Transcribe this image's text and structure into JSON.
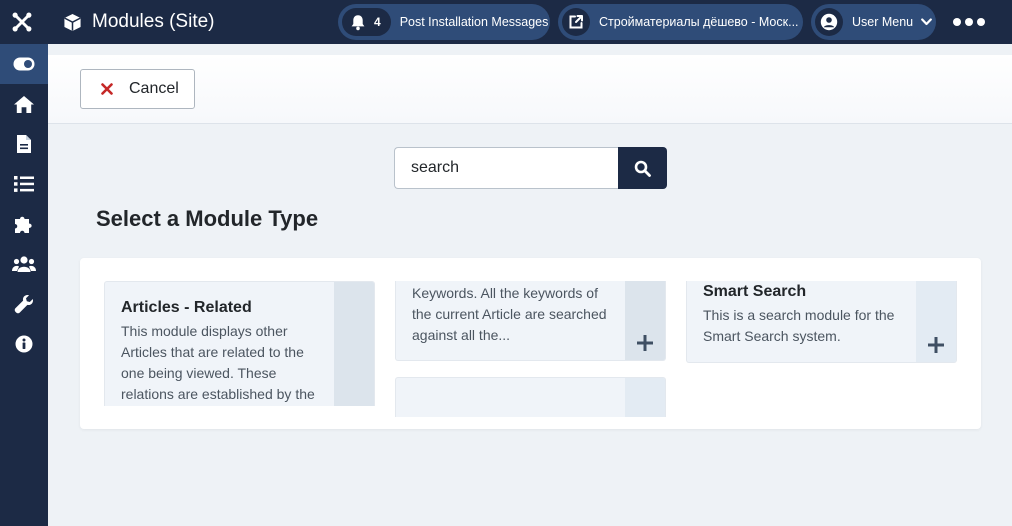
{
  "header": {
    "title": "Modules (Site)",
    "notifications": {
      "count": "4",
      "label": "Post Installation Messages"
    },
    "site_link": {
      "label": "Стройматериалы дёшево - Моск..."
    },
    "user_menu": {
      "label": "User Menu"
    }
  },
  "sidebar": {
    "items": [
      {
        "icon": "toggle-menu-icon"
      },
      {
        "icon": "home-icon"
      },
      {
        "icon": "file-icon"
      },
      {
        "icon": "list-icon"
      },
      {
        "icon": "puzzle-icon"
      },
      {
        "icon": "users-icon"
      },
      {
        "icon": "wrench-icon"
      },
      {
        "icon": "info-icon"
      }
    ]
  },
  "toolbar": {
    "cancel_label": "Cancel"
  },
  "search": {
    "value": "search"
  },
  "main": {
    "section_title": "Select a Module Type",
    "modules": [
      {
        "title": "Articles - Related",
        "description": "This module displays other Articles that are related to the one being viewed. These relations are established by the"
      },
      {
        "title": "",
        "description": "Keywords. All the keywords of the current Article are searched against all the..."
      },
      {
        "title": "Smart Search",
        "description": "This is a search module for the Smart Search system."
      }
    ],
    "add_symbol": "+"
  },
  "colors": {
    "header_bg": "#1c2a45",
    "pill_bg": "#2f4c78",
    "page_bg": "#eef2f6",
    "card_bg": "#f0f4f9",
    "cancel_icon": "#c52827"
  }
}
